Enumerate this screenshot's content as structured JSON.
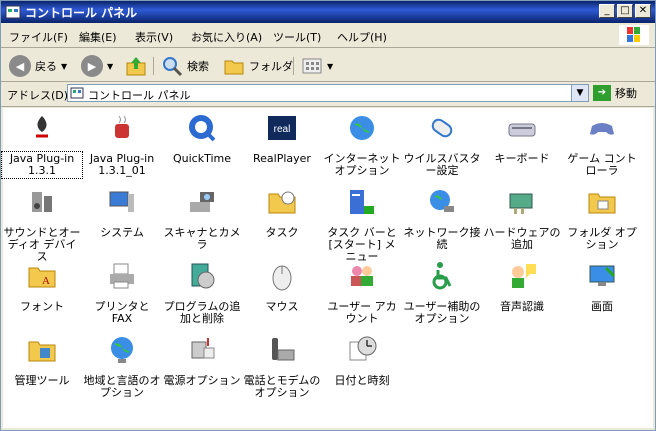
{
  "window": {
    "title": "コントロール パネル"
  },
  "menubar": {
    "items": [
      "ファイル(F)",
      "編集(E)",
      "表示(V)",
      "お気に入り(A)",
      "ツール(T)",
      "ヘルプ(H)"
    ]
  },
  "toolbar": {
    "back": "戻る",
    "search": "検索",
    "folders": "フォルダ"
  },
  "addressbar": {
    "label": "アドレス(D)",
    "value": "コントロール パネル",
    "go": "移動"
  },
  "items": [
    {
      "label": "Java Plug-in 1.3.1",
      "icon": "java-icon"
    },
    {
      "label": "Java Plug-in 1.3.1_01",
      "icon": "java-cup-icon"
    },
    {
      "label": "QuickTime",
      "icon": "quicktime-icon"
    },
    {
      "label": "RealPlayer",
      "icon": "realplayer-icon"
    },
    {
      "label": "インターネット オプション",
      "icon": "globe-icon"
    },
    {
      "label": "ウイルスバスター設定",
      "icon": "virus-capsule-icon"
    },
    {
      "label": "キーボード",
      "icon": "keyboard-icon"
    },
    {
      "label": "ゲーム コントローラ",
      "icon": "gamepad-icon"
    },
    {
      "label": "サウンドとオーディオ デバイス",
      "icon": "speaker-icon"
    },
    {
      "label": "システム",
      "icon": "system-icon"
    },
    {
      "label": "スキャナとカメラ",
      "icon": "scanner-camera-icon"
    },
    {
      "label": "タスク",
      "icon": "tasks-folder-icon"
    },
    {
      "label": "タスク バーと [スタート] メニュー",
      "icon": "taskbar-icon"
    },
    {
      "label": "ネットワーク接続",
      "icon": "network-icon"
    },
    {
      "label": "ハードウェアの追加",
      "icon": "hardware-icon"
    },
    {
      "label": "フォルダ オプション",
      "icon": "folder-options-icon"
    },
    {
      "label": "フォント",
      "icon": "fonts-folder-icon"
    },
    {
      "label": "プリンタと FAX",
      "icon": "printer-icon"
    },
    {
      "label": "プログラムの追加と削除",
      "icon": "add-remove-programs-icon"
    },
    {
      "label": "マウス",
      "icon": "mouse-icon"
    },
    {
      "label": "ユーザー アカウント",
      "icon": "user-accounts-icon"
    },
    {
      "label": "ユーザー補助のオプション",
      "icon": "accessibility-icon"
    },
    {
      "label": "音声認識",
      "icon": "speech-icon"
    },
    {
      "label": "画面",
      "icon": "display-icon"
    },
    {
      "label": "管理ツール",
      "icon": "admin-tools-icon"
    },
    {
      "label": "地域と言語のオプション",
      "icon": "regional-globe-icon"
    },
    {
      "label": "電源オプション",
      "icon": "power-icon"
    },
    {
      "label": "電話とモデムのオプション",
      "icon": "phone-modem-icon"
    },
    {
      "label": "日付と時刻",
      "icon": "clock-icon"
    }
  ]
}
